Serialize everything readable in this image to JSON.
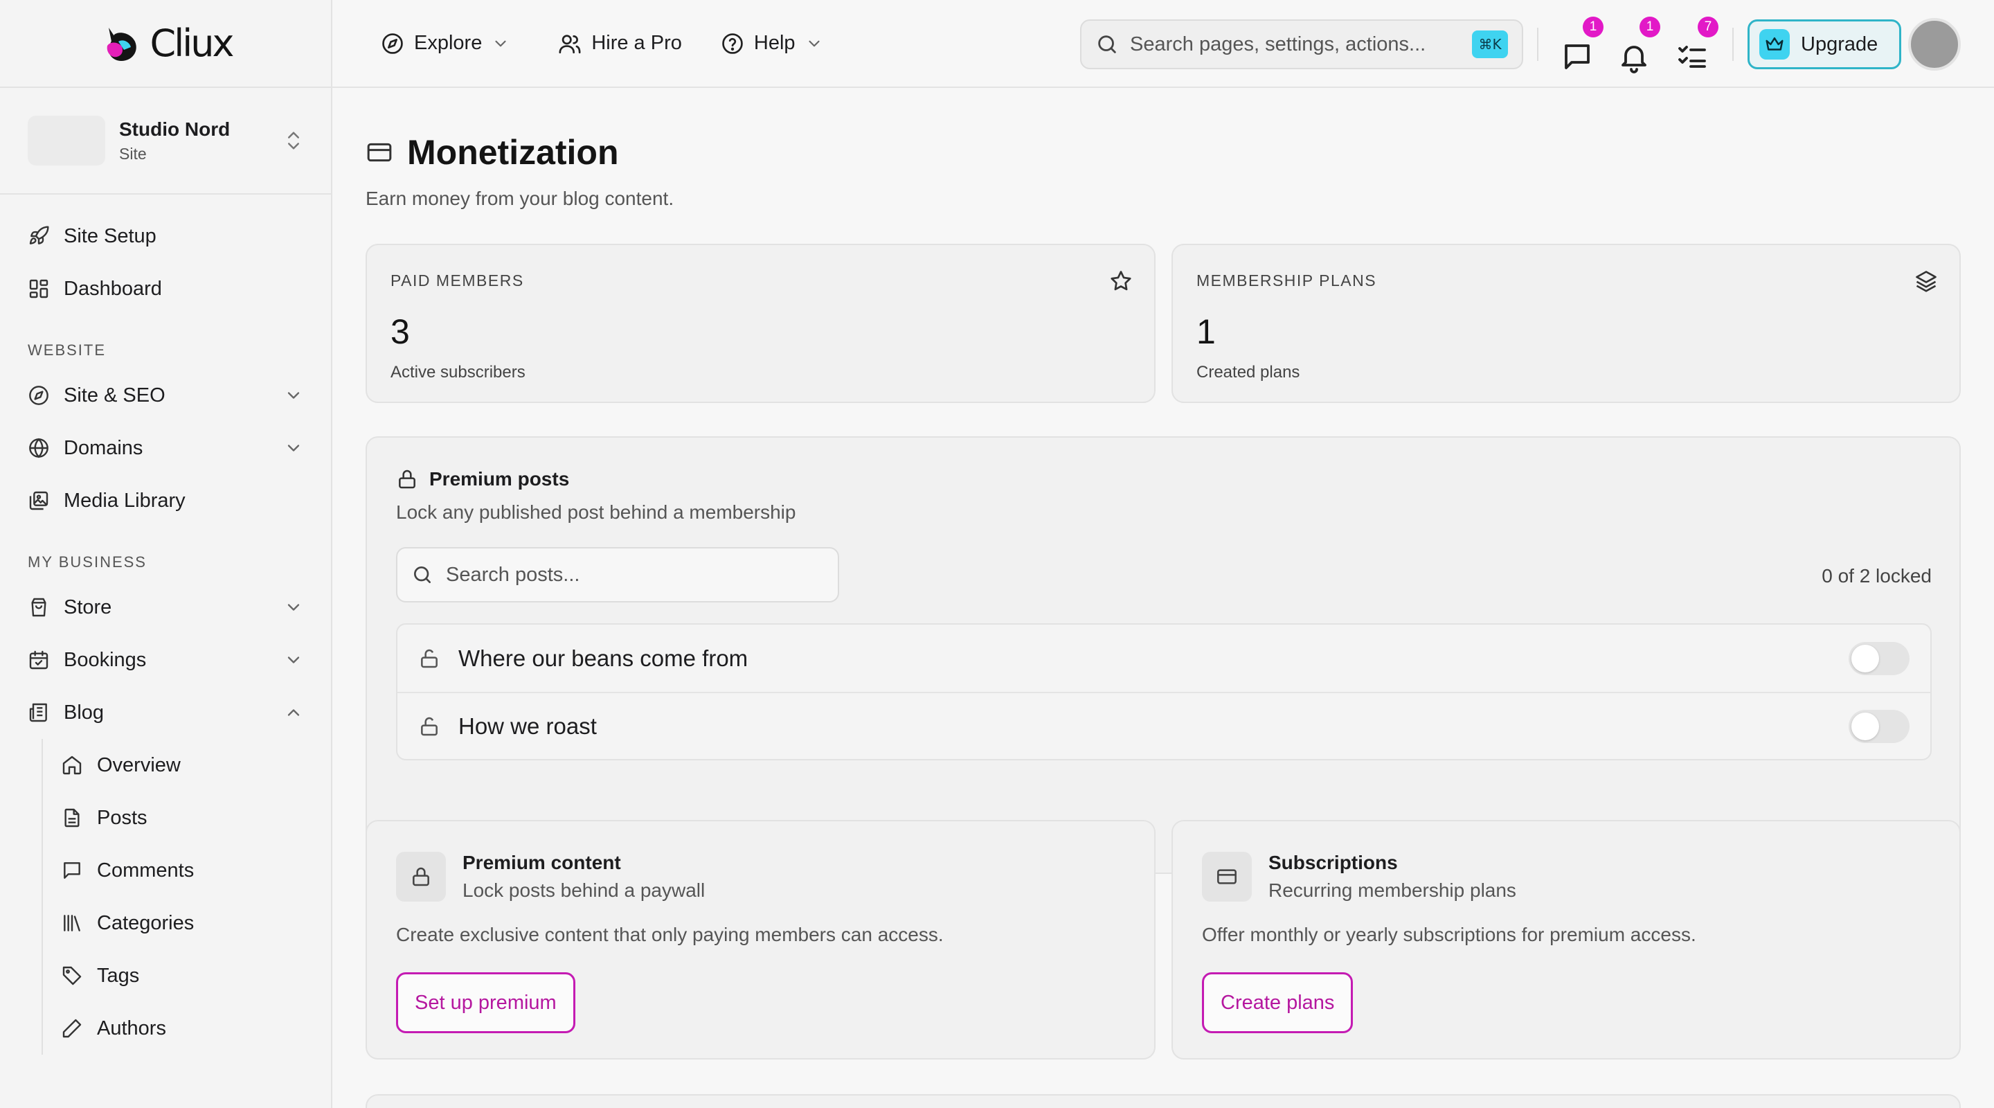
{
  "app": {
    "brand_name": "Cliux"
  },
  "colors": {
    "accent": "#c41bb3",
    "badge": "#e219c7",
    "upgrade": "#3fd3f0"
  },
  "site": {
    "name": "Studio Nord",
    "type": "Site"
  },
  "sidebar": {
    "top_items": [
      {
        "label": "Site Setup",
        "icon": "rocket-icon"
      },
      {
        "label": "Dashboard",
        "icon": "dashboard-icon"
      }
    ],
    "sections": [
      {
        "title": "WEBSITE",
        "items": [
          {
            "label": "Site & SEO",
            "icon": "compass-icon",
            "expanded": false
          },
          {
            "label": "Domains",
            "icon": "globe-icon",
            "expanded": false
          },
          {
            "label": "Media Library",
            "icon": "images-icon"
          }
        ]
      },
      {
        "title": "MY BUSINESS",
        "items": [
          {
            "label": "Store",
            "icon": "shopping-bag-icon",
            "expanded": false
          },
          {
            "label": "Bookings",
            "icon": "calendar-icon",
            "expanded": false
          },
          {
            "label": "Blog",
            "icon": "newspaper-icon",
            "expanded": true
          }
        ]
      }
    ],
    "blog_items": [
      {
        "label": "Overview",
        "icon": "home-icon"
      },
      {
        "label": "Posts",
        "icon": "file-icon"
      },
      {
        "label": "Comments",
        "icon": "message-icon"
      },
      {
        "label": "Categories",
        "icon": "library-icon"
      },
      {
        "label": "Tags",
        "icon": "tag-icon"
      },
      {
        "label": "Authors",
        "icon": "pen-icon"
      }
    ]
  },
  "topbar": {
    "explore": "Explore",
    "hire": "Hire a Pro",
    "help": "Help",
    "search_placeholder": "Search pages, settings, actions...",
    "shortcut": "⌘K",
    "messages_count": "1",
    "notifications_count": "1",
    "tasks_count": "7",
    "upgrade": "Upgrade"
  },
  "page": {
    "title": "Monetization",
    "subtitle": "Earn money from your blog content."
  },
  "stats": [
    {
      "label": "PAID MEMBERS",
      "value": "3",
      "desc": "Active subscribers",
      "icon": "star-icon"
    },
    {
      "label": "MEMBERSHIP PLANS",
      "value": "1",
      "desc": "Created plans",
      "icon": "layers-icon"
    }
  ],
  "premium_posts": {
    "title": "Premium posts",
    "subtitle": "Lock any published post behind a membership",
    "search_placeholder": "Search posts...",
    "locked_count": "0 of 2 locked",
    "posts": [
      {
        "title": "Where our beans come from",
        "locked": false
      },
      {
        "title": "How we roast",
        "locked": false
      }
    ]
  },
  "features": [
    {
      "title": "Premium content",
      "subtitle": "Lock posts behind a paywall",
      "desc": "Create exclusive content that only paying members can access.",
      "button": "Set up premium",
      "icon": "lock-icon"
    },
    {
      "title": "Subscriptions",
      "subtitle": "Recurring membership plans",
      "desc": "Offer monthly or yearly subscriptions for premium access.",
      "button": "Create plans",
      "icon": "credit-card-icon"
    }
  ]
}
